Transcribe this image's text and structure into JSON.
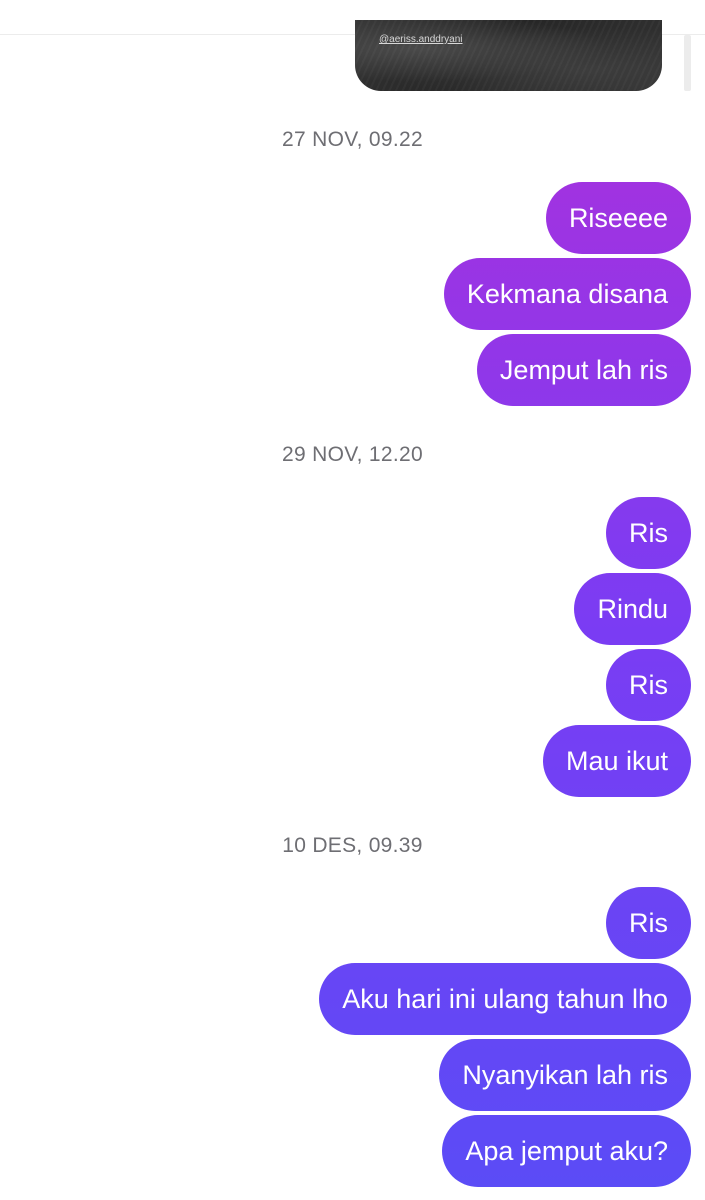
{
  "shared_post": {
    "caption": "@aeriss.anddryani"
  },
  "conversation": {
    "groups": [
      {
        "timestamp": "27 NOV, 09.22",
        "messages": [
          "Riseeee",
          "Kekmana disana",
          "Jemput lah ris"
        ]
      },
      {
        "timestamp": "29 NOV, 12.20",
        "messages": [
          "Ris",
          "Rindu",
          "Ris",
          "Mau ikut"
        ]
      },
      {
        "timestamp": "10 DES, 09.39",
        "messages": [
          "Ris",
          "Aku hari ini ulang tahun lho",
          "Nyanyikan lah ris",
          "Apa jemput aku?"
        ]
      }
    ]
  },
  "colors": {
    "bubble_gradient_top": "#b02fd9",
    "bubble_gradient_mid": "#7b3cf3",
    "bubble_gradient_bottom": "#5a4cf6",
    "timestamp_text": "#6e6e73",
    "background": "#ffffff"
  }
}
